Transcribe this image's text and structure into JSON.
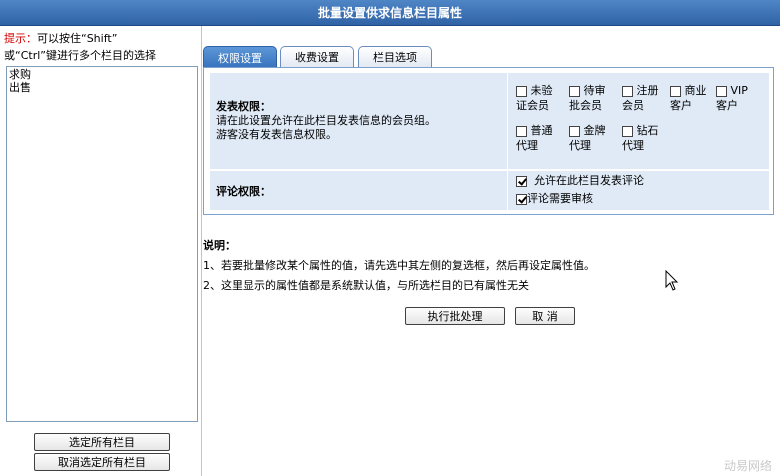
{
  "window": {
    "title": "批量设置供求信息栏目属性"
  },
  "sidebar": {
    "hint_prefix": "提示：",
    "hint_line1": "可以按住“Shift”",
    "hint_line2": "或“Ctrl”键进行多个栏目的选择",
    "items": [
      "求购",
      "出售"
    ],
    "select_all_label": "选定所有栏目",
    "deselect_all_label": "取消选定所有栏目"
  },
  "tabs": [
    {
      "label": "权限设置",
      "active": true
    },
    {
      "label": "收费设置",
      "active": false
    },
    {
      "label": "栏目选项",
      "active": false
    }
  ],
  "permissions": {
    "publish_title": "发表权限：",
    "publish_desc1": "请在此设置允许在此栏目发表信息的会员组。",
    "publish_desc2": "游客没有发表信息权限。",
    "groups": [
      {
        "line1": "未验",
        "line2": "证会员",
        "checked": false
      },
      {
        "line1": "待审",
        "line2": "批会员",
        "checked": false
      },
      {
        "line1": "注册",
        "line2": "会员",
        "checked": false
      },
      {
        "line1": "商业",
        "line2": "客户",
        "checked": false
      },
      {
        "line1": "VIP",
        "line2": "客户",
        "checked": false
      },
      {
        "line1": "普通",
        "line2": "代理",
        "checked": false
      },
      {
        "line1": "金牌",
        "line2": "代理",
        "checked": false
      },
      {
        "line1": "钻石",
        "line2": "代理",
        "checked": false
      }
    ],
    "comment_title": "评论权限：",
    "comment_options": [
      {
        "label": "允许在此栏目发表评论",
        "checked": true
      },
      {
        "label": "评论需要审核",
        "checked": true
      }
    ]
  },
  "notes": {
    "title": "说明：",
    "line1": "1、若要批量修改某个属性的值，请先选中其左侧的复选框，然后再设定属性值。",
    "line2": "2、这里显示的属性值都是系统默认值，与所选栏目的已有属性无关"
  },
  "actions": {
    "execute_label": "执行批处理",
    "cancel_label": "取 消"
  },
  "watermark": "动易网络"
}
